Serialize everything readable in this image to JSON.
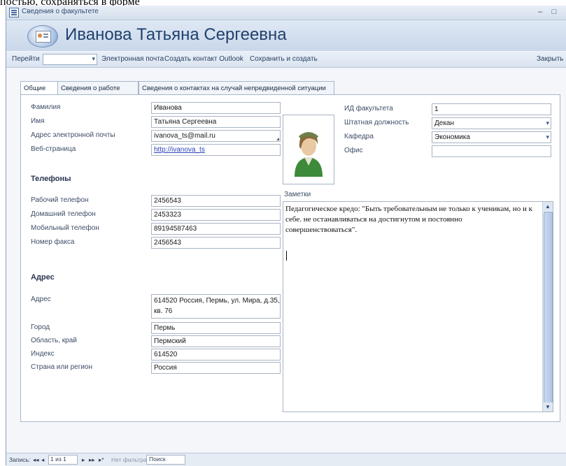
{
  "caption_text": "постью, сохраняться в форме",
  "window": {
    "title": "Сведения о факультете",
    "minimize": "–",
    "restore": "□",
    "header_title": "Иванова Татьяна Сергеевна"
  },
  "toolbar": {
    "goto_label": "Перейти",
    "email_label": "Электронная почта",
    "outlook_label": "Создать контакт Outlook",
    "save_new_label": "Сохранить и создать",
    "close_label": "Закрыть",
    "dropdown_glyph": "▾"
  },
  "tabs": [
    {
      "label": "Общие"
    },
    {
      "label": "Сведения о работе"
    },
    {
      "label": "Сведения о контактах на случай непредвиденной ситуации"
    }
  ],
  "general": {
    "last_name_label": "Фамилия",
    "last_name": "Иванова",
    "first_name_label": "Имя",
    "first_name": "Татьяна Сергеевна",
    "email_label": "Адрес электронной почты",
    "email": "ivanova_ts@mail.ru",
    "web_label": "Веб-страница",
    "web": "http://ivanova_ts"
  },
  "phones": {
    "section_title": "Телефоны",
    "work_label": "Рабочий телефон",
    "work": "2456543",
    "home_label": "Домашний телефон",
    "home": "2453323",
    "mobile_label": "Мобильный телефон",
    "mobile": "89194587463",
    "fax_label": "Номер факса",
    "fax": "2456543"
  },
  "address": {
    "section_title": "Адрес",
    "address_label": "Адрес",
    "address": "614520 Россия, Пермь, ул. Мира, д.35, кв. 76",
    "city_label": "Город",
    "city": "Пермь",
    "region_label": "Область, край",
    "region": "Пермский",
    "zip_label": "Индекс",
    "zip": "614520",
    "country_label": "Страна или регион",
    "country": "Россия"
  },
  "faculty": {
    "id_label": "ИД факультета",
    "id": "1",
    "position_label": "Штатная должность",
    "position": "Декан",
    "department_label": "Кафедра",
    "department": "Экономика",
    "office_label": "Офис",
    "office": ""
  },
  "notes": {
    "label": "Заметки",
    "text": "Педагогическое кредо: \"Быть требовательным не только к ученикам, но и к себе. не останавливаться на достигнутом и постоянно совершенствоваться\"."
  },
  "statusbar": {
    "record_label": "Запись:",
    "first": "◂◂",
    "prev": "◂",
    "position": "1 из 1",
    "next": "▸",
    "last": "▸▸",
    "new": "▸*",
    "filter": "Нет фильтра",
    "search": "Поиск"
  },
  "colors": {
    "accent": "#20416e",
    "link": "#2b43b8"
  }
}
